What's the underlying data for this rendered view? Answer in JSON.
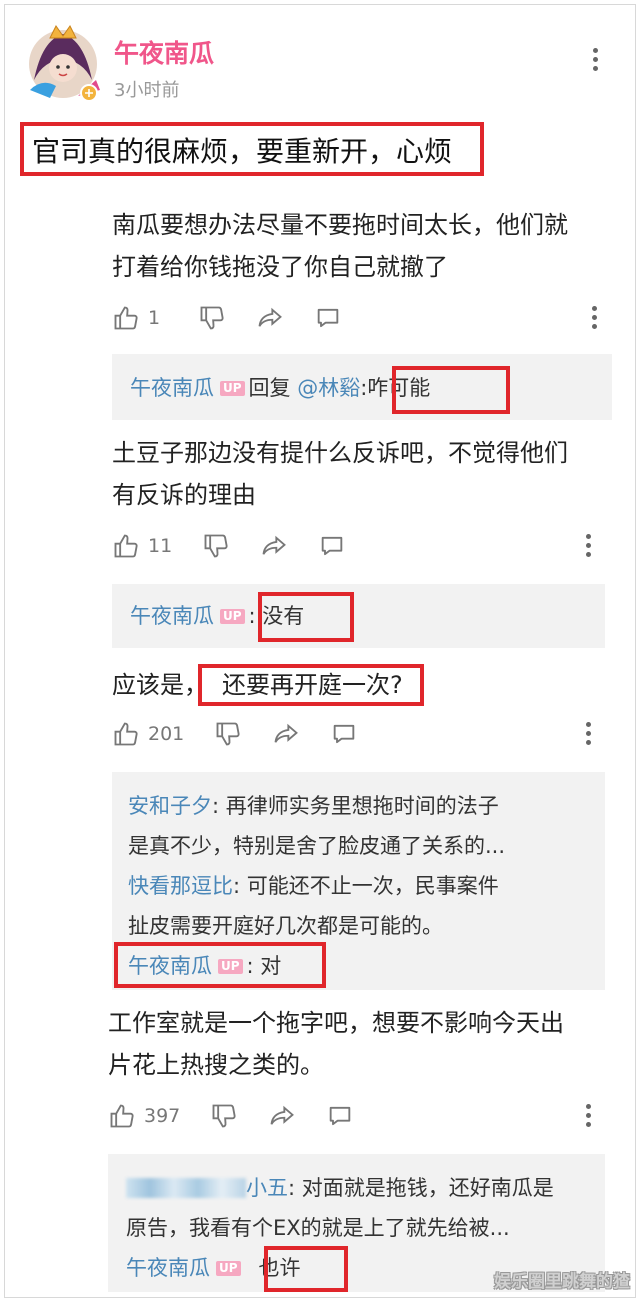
{
  "author": {
    "name": "午夜南瓜",
    "time": "3小时前"
  },
  "post": {
    "text": "官司真的很麻烦，要重新开，心烦"
  },
  "comments": [
    {
      "text_lines": [
        "南瓜要想办法尽量不要拖时间太长，他们就",
        "打着给你钱拖没了你自己就撤了"
      ],
      "likes": "1",
      "reply": {
        "user": "午夜南瓜",
        "badge": "UP",
        "reply_word": "回复",
        "mention": "@林谿",
        "text": ":咋可能"
      }
    },
    {
      "text_lines": [
        "土豆子那边没有提什么反诉吧，不觉得他们",
        "有反诉的理由"
      ],
      "likes": "11",
      "reply": {
        "user": "午夜南瓜",
        "badge": "UP",
        "text": ": 没有"
      }
    },
    {
      "text_prefix": "应该是，",
      "text_highlight": "还要再开庭一次?",
      "likes": "201",
      "replies": [
        {
          "user": "安和子夕",
          "text_lines": [
            ": 再律师实务里想拖时间的法子",
            "是真不少，特别是舍了脸皮通了关系的..."
          ]
        },
        {
          "user": "快看那逗比",
          "text_lines": [
            ": 可能还不止一次，民事案件",
            "扯皮需要开庭好几次都是可能的。"
          ]
        },
        {
          "user": "午夜南瓜",
          "badge": "UP",
          "text": ": 对"
        }
      ]
    },
    {
      "text_lines": [
        "工作室就是一个拖字吧，想要不影响今天出",
        "片花上热搜之类的。"
      ],
      "likes": "397",
      "replies": [
        {
          "user_text": "小五",
          "text_lines": [
            ": 对面就是拖钱，还好南瓜是",
            "原告，我看有个EX的就是上了就先给被..."
          ]
        },
        {
          "user": "午夜南瓜",
          "badge": "UP",
          "text": "也许"
        }
      ]
    }
  ],
  "watermark": "娱乐圈里跳舞的猹",
  "colors": {
    "author_pink": "#f0568a",
    "username_blue": "#4a87b8",
    "highlight_red": "#e0262b",
    "up_badge": "#f6a8c1"
  },
  "icons": [
    "like-icon",
    "dislike-icon",
    "share-icon",
    "comment-icon",
    "more-icon"
  ]
}
